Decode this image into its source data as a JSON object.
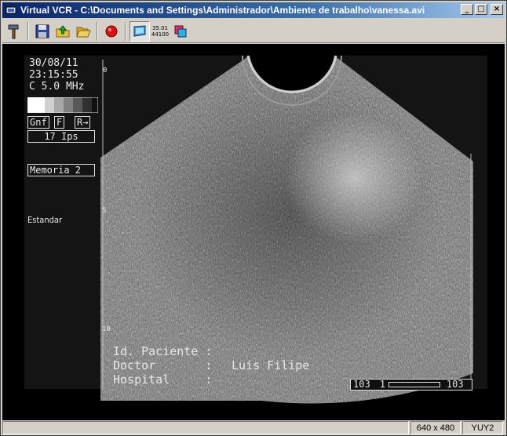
{
  "window": {
    "title": "Virtual VCR - C:\\Documents and Settings\\Administrador\\Ambiente de trabalho\\vanessa.avi",
    "minimize_label": "_",
    "maximize_label": "□",
    "close_label": "×"
  },
  "toolbar": {
    "items": [
      {
        "name": "settings-tool-button",
        "icon": "hammer-wrench-icon"
      },
      {
        "name": "save-button",
        "icon": "floppy-disk-icon"
      },
      {
        "name": "open-up-button",
        "icon": "folder-up-icon"
      },
      {
        "name": "open-folder-button",
        "icon": "open-folder-icon"
      },
      {
        "name": "record-button",
        "icon": "record-icon"
      },
      {
        "name": "preview-button",
        "icon": "monitor-icon",
        "pressed": true
      },
      {
        "name": "timecode-button",
        "icon": "timecode-icon",
        "line1": "35.01",
        "line2": "44100"
      },
      {
        "name": "overlay-button",
        "icon": "overlay-icon"
      }
    ]
  },
  "video": {
    "date": "30/08/11",
    "time": "23:15:55",
    "freq": "C 5.0 MHz",
    "btn_gnf": "Gnf",
    "btn_f": "F",
    "btn_r": "R→",
    "fps": "17 Ips",
    "memoria": "Memoria 2",
    "preset": "Estandar",
    "depth_top": "0",
    "depth_mid": "5",
    "depth_bottom": "10",
    "patient_label": "Id. Paciente :",
    "doctor_label": "Doctor       :",
    "doctor_value": "Luis Filipe",
    "hospital_label": "Hospital     :",
    "counter_left": "103",
    "counter_mid": "1",
    "counter_right": "103"
  },
  "status": {
    "resolution": "640 x 480",
    "format": "YUY2"
  }
}
